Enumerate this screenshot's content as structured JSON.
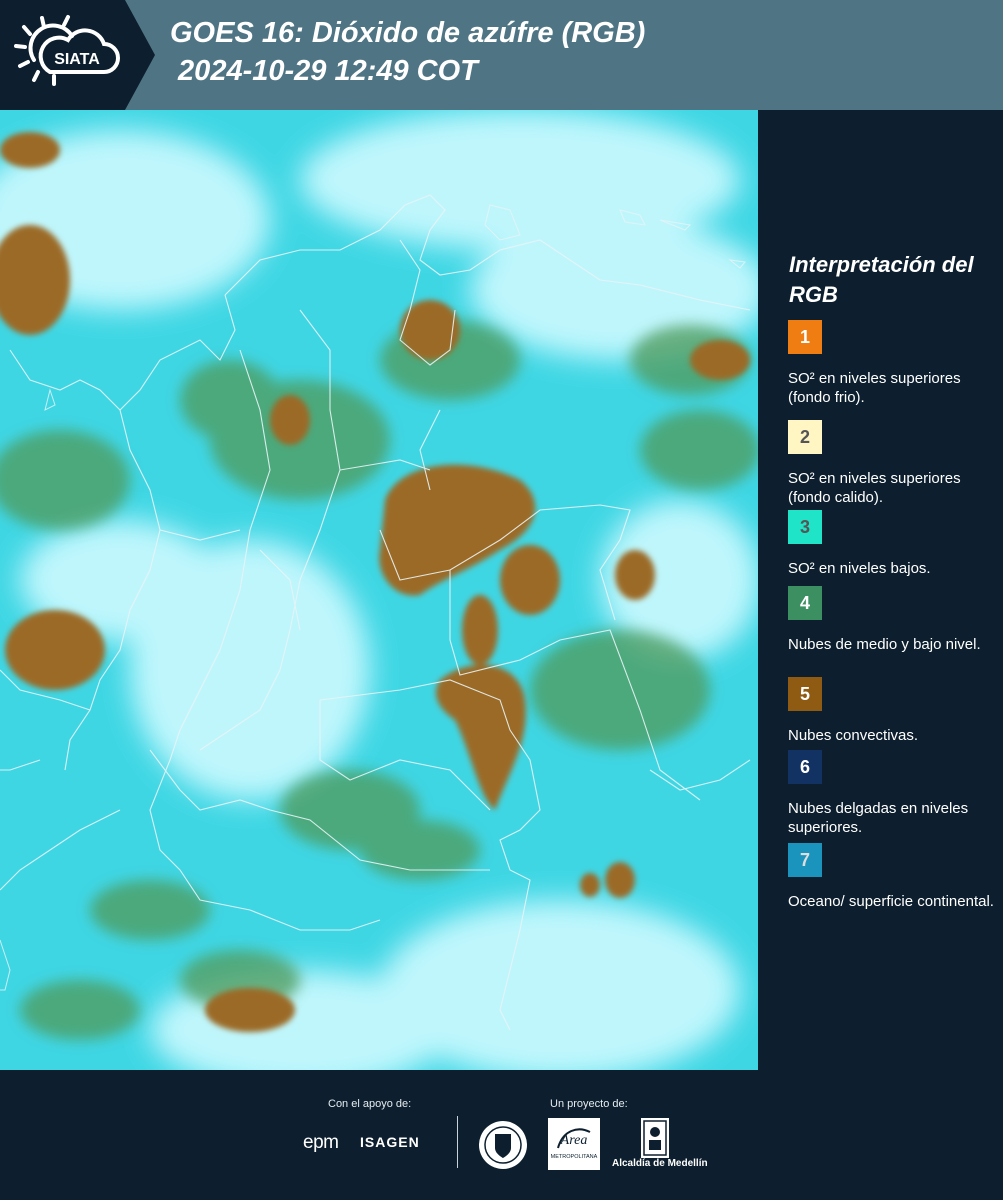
{
  "header": {
    "title": "GOES 16: Dióxido de azúfre (RGB)\n 2024-10-29 12:49 COT",
    "logo_text": "SIATA",
    "colors": {
      "bar": "#4f7585",
      "dark": "#0d1f2e"
    }
  },
  "map": {
    "image_description_icon": "satellite-rgb-map",
    "colors": {
      "background": "#3fd6e4",
      "cloud": "#cdfaff",
      "convective": "#9b6a28",
      "mid_low": "#4f9a5a",
      "borders": "#e8f4f6"
    }
  },
  "legend": {
    "title": "Interpretación del RGB",
    "items": [
      {
        "number": "1",
        "color": "#f07d12",
        "number_color": "#ffffff",
        "description": "SO² en niveles superiores (fondo frio)."
      },
      {
        "number": "2",
        "color": "#fff6c4",
        "number_color": "#555555",
        "description": "SO² en niveles superiores (fondo calido)."
      },
      {
        "number": "3",
        "color": "#1fe4c8",
        "number_color": "#555555",
        "description": "SO² en niveles bajos."
      },
      {
        "number": "4",
        "color": "#3b8f60",
        "number_color": "#ffffff",
        "description": "Nubes de medio y bajo nivel."
      },
      {
        "number": "5",
        "color": "#8f5a12",
        "number_color": "#ffffff",
        "description": "Nubes convectivas."
      },
      {
        "number": "6",
        "color": "#123263",
        "number_color": "#ffffff",
        "description": "Nubes delgadas en niveles superiores."
      },
      {
        "number": "7",
        "color": "#1a93bd",
        "number_color": "#dddddd",
        "description": "Oceano/ superficie continental."
      }
    ]
  },
  "footer": {
    "support_label": "Con el apoyo de:",
    "project_label": "Un proyecto de:",
    "sponsors": [
      "epm",
      "ISAGEN"
    ],
    "area_logo_text": "METROPOLITANA",
    "alcaldia_text": "Alcaldía de Medellín"
  }
}
